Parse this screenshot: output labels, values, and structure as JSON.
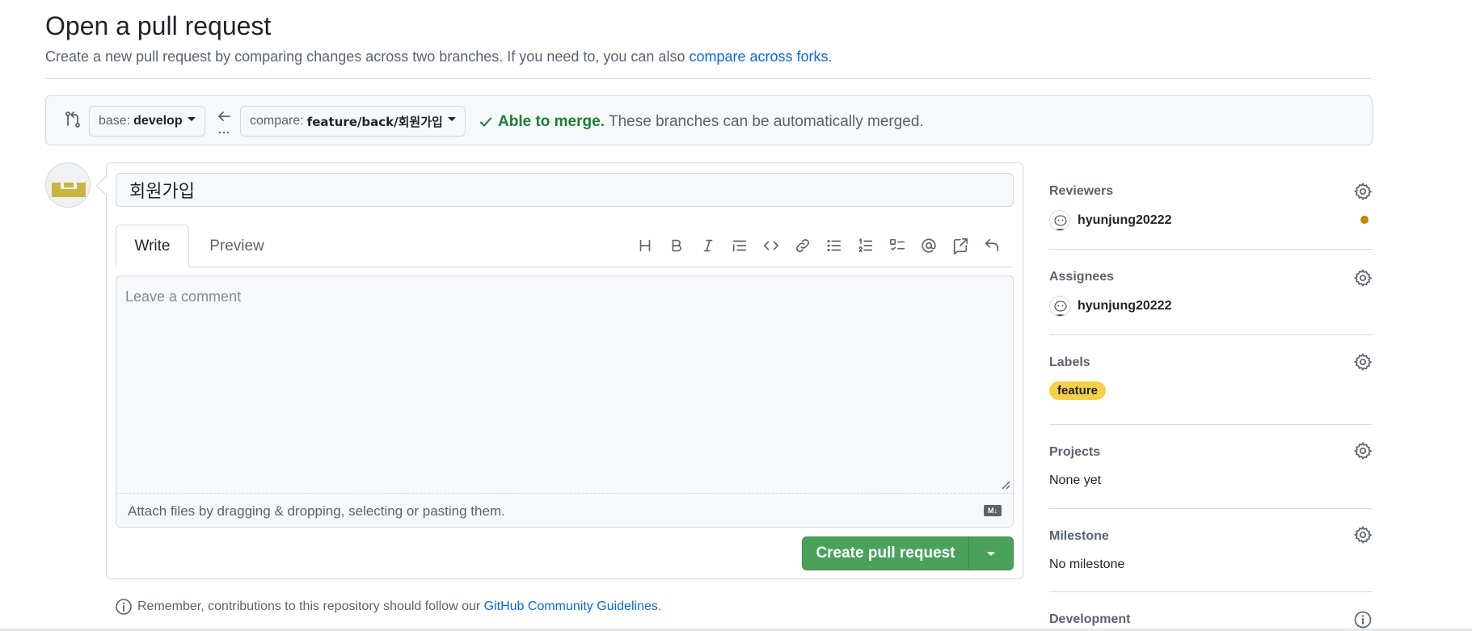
{
  "header": {
    "title": "Open a pull request",
    "subtitle_prefix": "Create a new pull request by comparing changes across two branches. If you need to, you can also",
    "subtitle_link": "compare across forks",
    "subtitle_suffix": "."
  },
  "compare": {
    "base_label": "base:",
    "base_value": "develop",
    "compare_label": "compare:",
    "compare_value": "feature/back/회원가입",
    "merge_ok": "Able to merge.",
    "merge_text": "These branches can be automatically merged."
  },
  "form": {
    "title_value": "회원가입",
    "tab_write": "Write",
    "tab_preview": "Preview",
    "comment_placeholder": "Leave a comment",
    "attach_text": "Attach files by dragging & dropping, selecting or pasting them.",
    "md_badge": "M↓",
    "create_button": "Create pull request"
  },
  "toolbar_icons": [
    "heading-icon",
    "bold-icon",
    "italic-icon",
    "quote-icon",
    "code-icon",
    "link-icon",
    "unordered-list-icon",
    "ordered-list-icon",
    "task-list-icon",
    "mention-icon",
    "cross-reference-icon",
    "reply-icon"
  ],
  "guidelines": {
    "prefix": "Remember, contributions to this repository should follow our",
    "link": "GitHub Community Guidelines",
    "suffix": "."
  },
  "sidebar": {
    "reviewers": {
      "heading": "Reviewers",
      "user": "hyunjung20222"
    },
    "assignees": {
      "heading": "Assignees",
      "user": "hyunjung20222"
    },
    "labels": {
      "heading": "Labels",
      "label": "feature"
    },
    "projects": {
      "heading": "Projects",
      "value": "None yet"
    },
    "milestone": {
      "heading": "Milestone",
      "value": "No milestone"
    },
    "development": {
      "heading": "Development"
    }
  },
  "colors": {
    "accent_link": "#0969da",
    "success": "#1a7f37",
    "create_button": "#4aa25a",
    "label_feature": "#f7d04a",
    "pending_dot": "#bf8700"
  }
}
